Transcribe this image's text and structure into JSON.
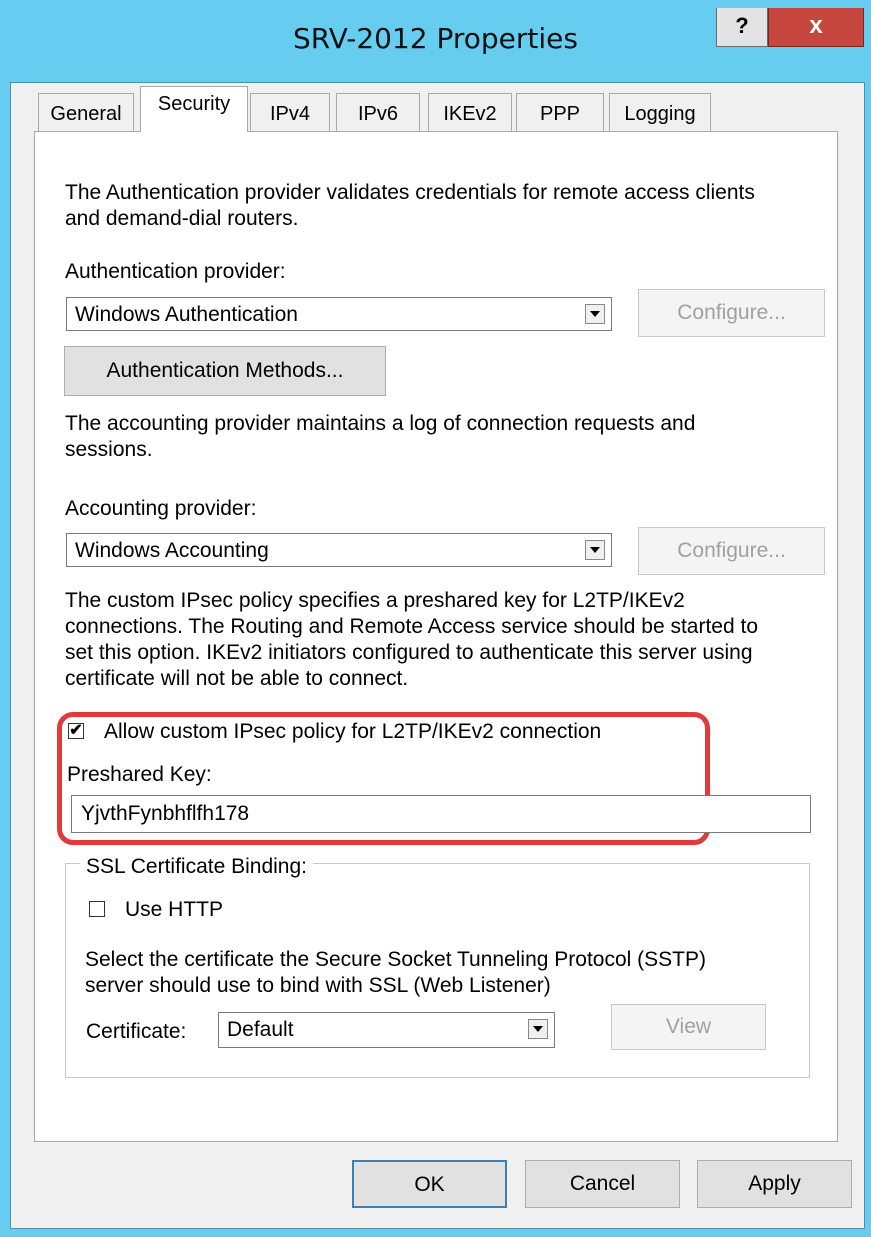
{
  "window": {
    "title": "SRV-2012 Properties",
    "help_label": "?",
    "close_label": "x"
  },
  "tabs": [
    {
      "label": "General",
      "selected": false
    },
    {
      "label": "Security",
      "selected": true
    },
    {
      "label": "IPv4",
      "selected": false
    },
    {
      "label": "IPv6",
      "selected": false
    },
    {
      "label": "IKEv2",
      "selected": false
    },
    {
      "label": "PPP",
      "selected": false
    },
    {
      "label": "Logging",
      "selected": false
    }
  ],
  "authentication": {
    "description_line1": "The Authentication provider validates credentials for remote access clients",
    "description_line2": "and demand-dial routers.",
    "label": "Authentication provider:",
    "selected": "Windows Authentication",
    "configure_label": "Configure...",
    "methods_label": "Authentication Methods..."
  },
  "accounting": {
    "description_line1": "The accounting provider maintains a log of connection requests and",
    "description_line2": "sessions.",
    "label": "Accounting provider:",
    "selected": "Windows Accounting",
    "configure_label": "Configure..."
  },
  "ipsec": {
    "description_line1": "The custom IPsec policy specifies a preshared key for L2TP/IKEv2",
    "description_line2": "connections. The Routing and Remote Access service should be started to",
    "description_line3": "set this option. IKEv2 initiators configured to authenticate this server using",
    "description_line4": "certificate will not be able to connect.",
    "checkbox_label": "Allow custom IPsec policy for L2TP/IKEv2 connection",
    "checked": true,
    "check_mark": "✔",
    "preshared_label": "Preshared Key:",
    "preshared_value": "YjvthFynbhflfh178"
  },
  "ssl": {
    "group_label": "SSL Certificate Binding:",
    "use_http_label": "Use HTTP",
    "use_http_checked": false,
    "description_line1": "Select the certificate the Secure Socket Tunneling Protocol (SSTP)",
    "description_line2": "server should use to bind with SSL (Web Listener)",
    "certificate_label": "Certificate:",
    "certificate_selected": "Default",
    "view_label": "View"
  },
  "footer": {
    "ok_label": "OK",
    "cancel_label": "Cancel",
    "apply_label": "Apply"
  },
  "colors": {
    "titlebar": "#67cdf0",
    "close_button": "#c6473e",
    "highlight": "#e03a3a"
  }
}
